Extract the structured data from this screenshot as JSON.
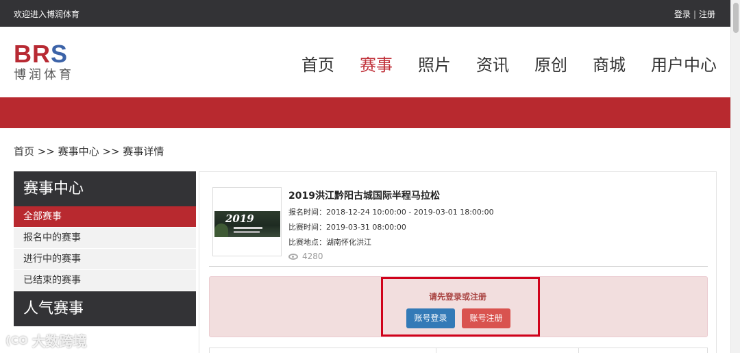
{
  "topbar": {
    "welcome": "欢迎进入博润体育",
    "login": "登录",
    "separator": "|",
    "register": "注册"
  },
  "logo": {
    "letters_br": "BR",
    "letters_s": "S",
    "subtitle": "博润体育"
  },
  "nav": {
    "items": [
      "首页",
      "赛事",
      "照片",
      "资讯",
      "原创",
      "商城",
      "用户中心"
    ],
    "active": "赛事"
  },
  "breadcrumb": "首页 >> 赛事中心 >> 赛事详情",
  "sidebar": {
    "title": "赛事中心",
    "items": [
      "全部赛事",
      "报名中的赛事",
      "进行中的赛事",
      "已结束的赛事"
    ],
    "active_index": 0,
    "title2": "人气赛事"
  },
  "event": {
    "thumb_year": "2019",
    "title": "2019洪江黔阳古城国际半程马拉松",
    "signup_time": "报名时间：2018-12-24 10:00:00 - 2019-03-01 18:00:00",
    "race_time": "比赛时间：2019-03-31 08:00:00",
    "location": "比赛地点：湖南怀化洪江",
    "views": "4280"
  },
  "alert": {
    "message": "请先登录或注册",
    "login_button": "账号登录",
    "register_button": "账号注册"
  },
  "watermark": {
    "mark": "(CO",
    "text": "大数跨境"
  },
  "colors": {
    "brand_red": "#b8292f",
    "dark_bar": "#333336",
    "primary_blue": "#337ab7",
    "danger_red": "#d9534f",
    "alert_bg": "#f2dede",
    "highlight": "#d0021b"
  }
}
